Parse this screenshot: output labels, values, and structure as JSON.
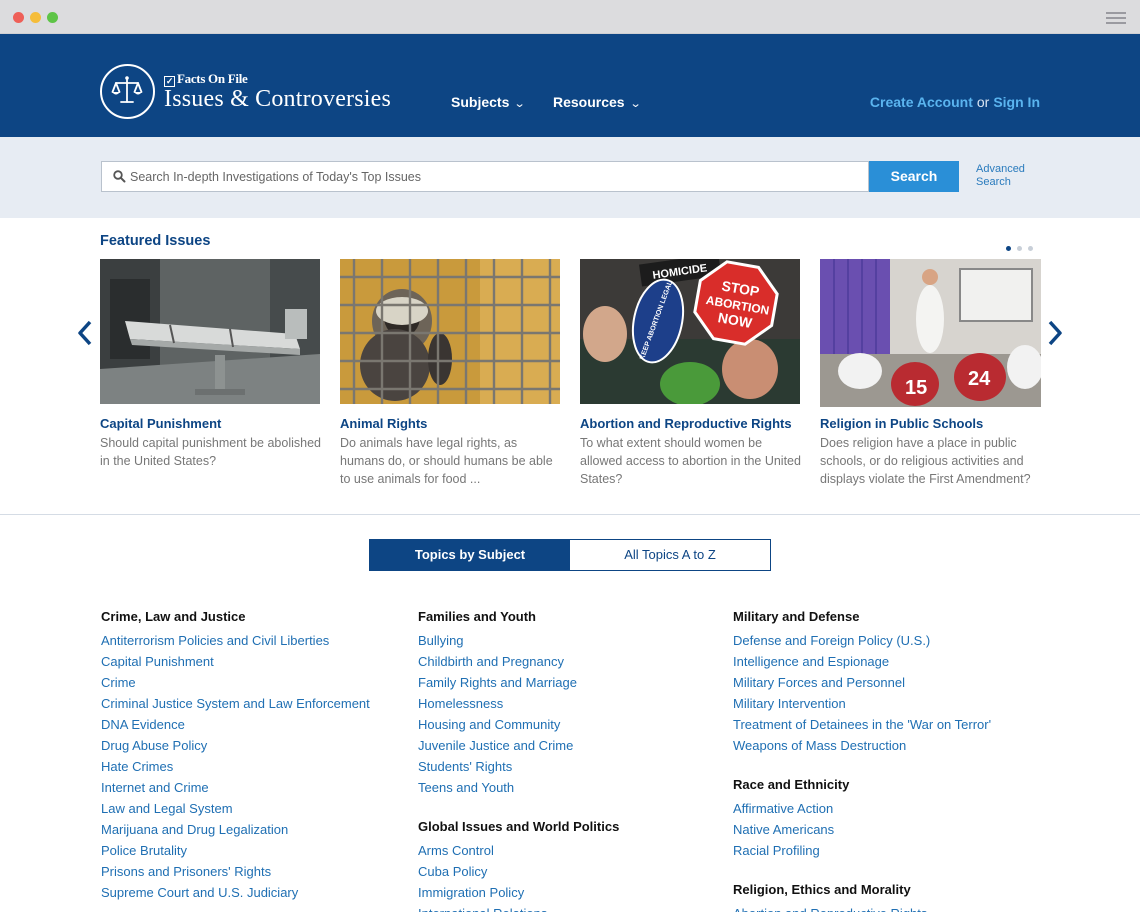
{
  "header": {
    "brand": "Facts On File",
    "title": "Issues & Controversies",
    "nav": [
      {
        "label": "Subjects"
      },
      {
        "label": "Resources"
      }
    ],
    "create_account": "Create Account",
    "or": "or",
    "sign_in": "Sign In"
  },
  "search": {
    "placeholder": "Search In-depth Investigations of Today's Top Issues",
    "button": "Search",
    "advanced": "Advanced Search"
  },
  "featured": {
    "title": "Featured Issues",
    "pages": 3,
    "current_page": 1,
    "cards": [
      {
        "title": "Capital Punishment",
        "desc": "Should capital punishment be abolished in the United States?"
      },
      {
        "title": "Animal Rights",
        "desc": "Do animals have legal rights, as humans do, or should humans be able to use animals for food ..."
      },
      {
        "title": "Abortion and Reproductive Rights",
        "desc": "To what extent should women be allowed access to abortion in the United States?"
      },
      {
        "title": "Religion in Public Schools",
        "desc": "Does religion have a place in public schools, or do religious activities and displays violate the First Amendment?"
      }
    ],
    "image_texts": {
      "stop_sign": "STOP ABORTION NOW",
      "sign_keep": "KEEP ABORTION LEGAL",
      "sign_homicide": "HOMICIDE",
      "jersey_1": "15",
      "jersey_2": "24"
    }
  },
  "tabs": {
    "by_subject": "Topics by Subject",
    "a_to_z": "All Topics A to Z"
  },
  "columns": [
    [
      {
        "heading": "Crime, Law and Justice",
        "links": [
          "Antiterrorism Policies and Civil Liberties",
          "Capital Punishment",
          "Crime",
          "Criminal Justice System and Law Enforcement",
          "DNA Evidence",
          "Drug Abuse Policy",
          "Hate Crimes",
          "Internet and Crime",
          "Law and Legal System",
          "Marijuana and Drug Legalization",
          "Police Brutality",
          "Prisons and Prisoners' Rights",
          "Supreme Court and U.S. Judiciary"
        ]
      }
    ],
    [
      {
        "heading": "Families and Youth",
        "links": [
          "Bullying",
          "Childbirth and Pregnancy",
          "Family Rights and Marriage",
          "Homelessness",
          "Housing and Community",
          "Juvenile Justice and Crime",
          "Students' Rights",
          "Teens and Youth"
        ]
      },
      {
        "heading": "Global Issues and World Politics",
        "links": [
          "Arms Control",
          "Cuba Policy",
          "Immigration Policy",
          "International Relations"
        ]
      }
    ],
    [
      {
        "heading": "Military and Defense",
        "links": [
          "Defense and Foreign Policy (U.S.)",
          "Intelligence and Espionage",
          "Military Forces and Personnel",
          "Military Intervention",
          "Treatment of Detainees in the 'War on Terror'",
          "Weapons of Mass Destruction"
        ]
      },
      {
        "heading": "Race and Ethnicity",
        "links": [
          "Affirmative Action",
          "Native Americans",
          "Racial Profiling"
        ]
      },
      {
        "heading": "Religion, Ethics and Morality",
        "links": [
          "Abortion and Reproductive Rights"
        ]
      }
    ]
  ],
  "colors": {
    "brand_navy": "#0d4584",
    "link_blue": "#1f6fb3",
    "accent_blue": "#2a8fd7",
    "account_link": "#5ab4ef"
  }
}
